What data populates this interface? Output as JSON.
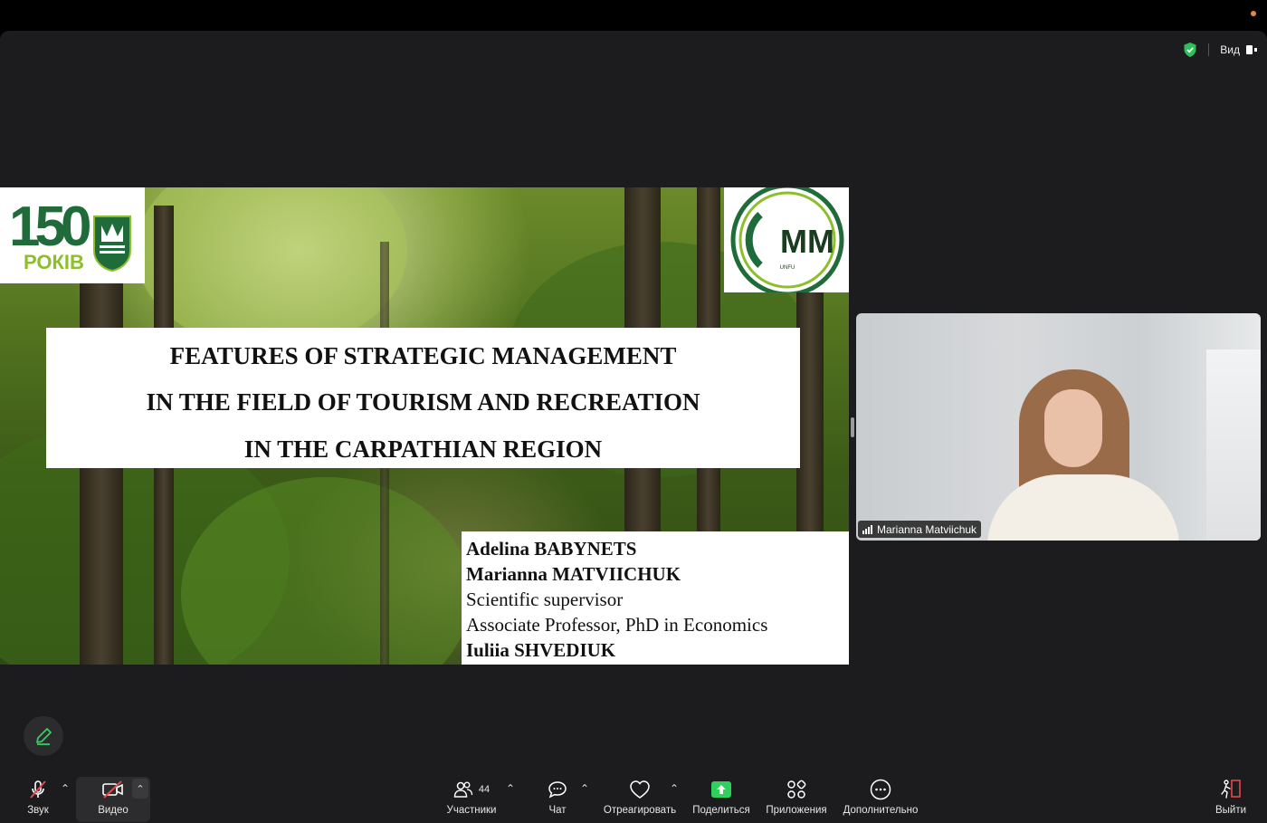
{
  "header": {
    "view_label": "Вид"
  },
  "slide": {
    "logo_left_number": "150",
    "logo_left_word": "РОКІВ",
    "logo_right_text": "MM",
    "logo_right_caption": "UNFU",
    "title_lines": [
      "FEATURES OF STRATEGIC MANAGEMENT",
      "IN THE FIELD OF TOURISM AND RECREATION",
      "IN THE CARPATHIAN REGION"
    ],
    "authors": [
      "Adelina BABYNETS",
      "Marianna MATVIICHUK",
      "Scientific supervisor",
      "Associate Professor, PhD in Economics",
      "Iuliia SHVEDIUK"
    ]
  },
  "participant": {
    "name": "Marianna Matviichuk"
  },
  "toolbar": {
    "audio_label": "Звук",
    "video_label": "Видео",
    "participants_label": "Участники",
    "participants_count": "44",
    "chat_label": "Чат",
    "react_label": "Отреагировать",
    "share_label": "Поделиться",
    "apps_label": "Приложения",
    "more_label": "Дополнительно",
    "leave_label": "Выйти"
  },
  "colors": {
    "window_bg": "#1c1c1e",
    "share_green": "#2fd05b",
    "leave_red": "#e5484d",
    "shield_green": "#2fbf5a"
  }
}
